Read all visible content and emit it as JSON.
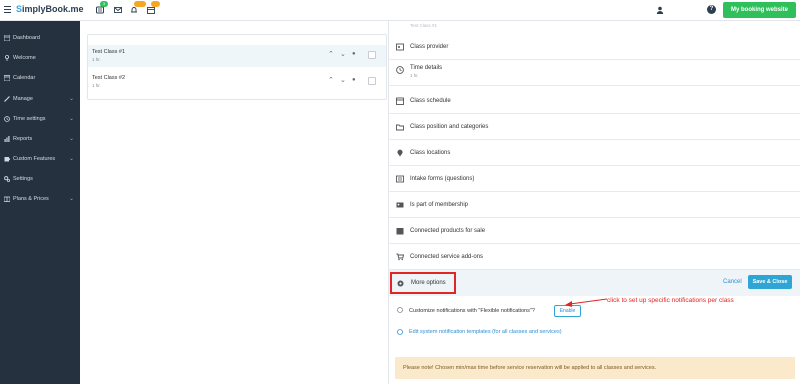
{
  "app": {
    "logo_mark": "S",
    "logo_text": "implyBook.me"
  },
  "topbar": {
    "badge_1": "3",
    "badge_2": "",
    "badge_3": "",
    "help_label": "?",
    "booking_button": "My booking website"
  },
  "sidebar": {
    "items": [
      {
        "label": "Dashboard",
        "icon": "dashboard-icon",
        "has_chevron": false
      },
      {
        "label": "Welcome",
        "icon": "pin-icon",
        "has_chevron": false
      },
      {
        "label": "Calendar",
        "icon": "calendar-icon",
        "has_chevron": false
      },
      {
        "label": "Manage",
        "icon": "pencil-icon",
        "has_chevron": true
      },
      {
        "label": "Time settings",
        "icon": "clock-icon",
        "has_chevron": true
      },
      {
        "label": "Reports",
        "icon": "bar-chart-icon",
        "has_chevron": true
      },
      {
        "label": "Custom Features",
        "icon": "puzzle-icon",
        "has_chevron": true
      },
      {
        "label": "Settings",
        "icon": "gears-icon",
        "has_chevron": false
      },
      {
        "label": "Plans & Prices",
        "icon": "card-icon",
        "has_chevron": true
      }
    ]
  },
  "classes": [
    {
      "name": "Test Class #1",
      "duration": "1 hr."
    },
    {
      "name": "Test Class #2",
      "duration": "1 hr."
    }
  ],
  "panel": {
    "top_partial": "Test Class #1",
    "rows": [
      {
        "label": "Class provider",
        "sub": ""
      },
      {
        "label": "Time details",
        "sub": "1 hr."
      },
      {
        "label": "Class schedule",
        "sub": ""
      },
      {
        "label": "Class position and categories",
        "sub": ""
      },
      {
        "label": "Class locations",
        "sub": ""
      },
      {
        "label": "Intake forms (questions)",
        "sub": ""
      },
      {
        "label": "Is part of membership",
        "sub": ""
      },
      {
        "label": "Connected products for sale",
        "sub": ""
      },
      {
        "label": "Connected service add-ons",
        "sub": ""
      }
    ],
    "more_options": "More options",
    "cancel": "Cancel",
    "save_close": "Save & Close",
    "customize_text": "Customize notifications with \"Flexible notifications\"?",
    "enable": "Enable",
    "edit_link": "Edit system notification templates (for all classes and services)",
    "note": "Please note! Chosen min/max time before service reservation will be applied to all classes and services."
  },
  "annotation": "click to set up specific notifications per class",
  "colors": {
    "sidebar_bg": "#25313f",
    "accent_green": "#2fbf5b",
    "accent_blue": "#2fa5d6",
    "highlight_red": "#e12424",
    "note_bg": "#fbe9cc"
  }
}
